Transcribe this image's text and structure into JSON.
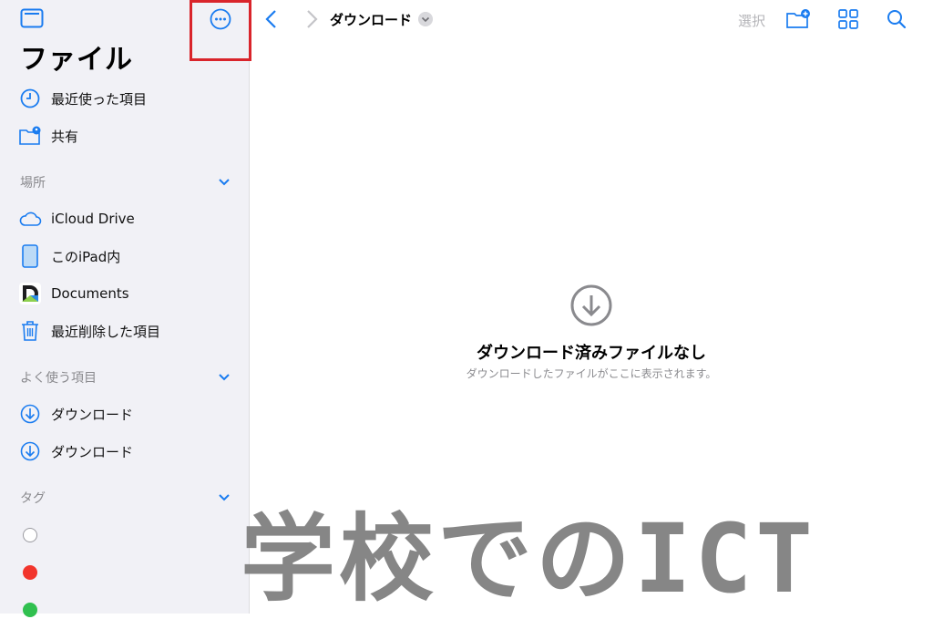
{
  "sidebar": {
    "title": "ファイル",
    "items_top": [
      {
        "label": "最近使った項目",
        "icon": "clock-icon"
      },
      {
        "label": "共有",
        "icon": "shared-folder-icon"
      }
    ],
    "locations_header": "場所",
    "locations": [
      {
        "label": "iCloud Drive",
        "icon": "cloud-icon"
      },
      {
        "label": "このiPad内",
        "icon": "ipad-icon"
      },
      {
        "label": "Documents",
        "icon": "documents-app-icon"
      },
      {
        "label": "最近削除した項目",
        "icon": "trash-icon"
      }
    ],
    "favorites_header": "よく使う項目",
    "favorites": [
      {
        "label": "ダウンロード",
        "icon": "download-icon"
      },
      {
        "label": "ダウンロード",
        "icon": "download-icon"
      }
    ],
    "tags_header": "タグ",
    "tags": [
      {
        "color": "#ffffff",
        "border": "#9a9aa0"
      },
      {
        "color": "#f2352c",
        "border": "#f2352c"
      },
      {
        "color": "#30c04f",
        "border": "#30c04f"
      }
    ]
  },
  "toolbar": {
    "breadcrumb": "ダウンロード",
    "select_label": "選択",
    "accent": "#1a7cf0"
  },
  "empty_state": {
    "title": "ダウンロード済みファイルなし",
    "subtitle": "ダウンロードしたファイルがここに表示されます。"
  },
  "watermark": "学校でのICT"
}
